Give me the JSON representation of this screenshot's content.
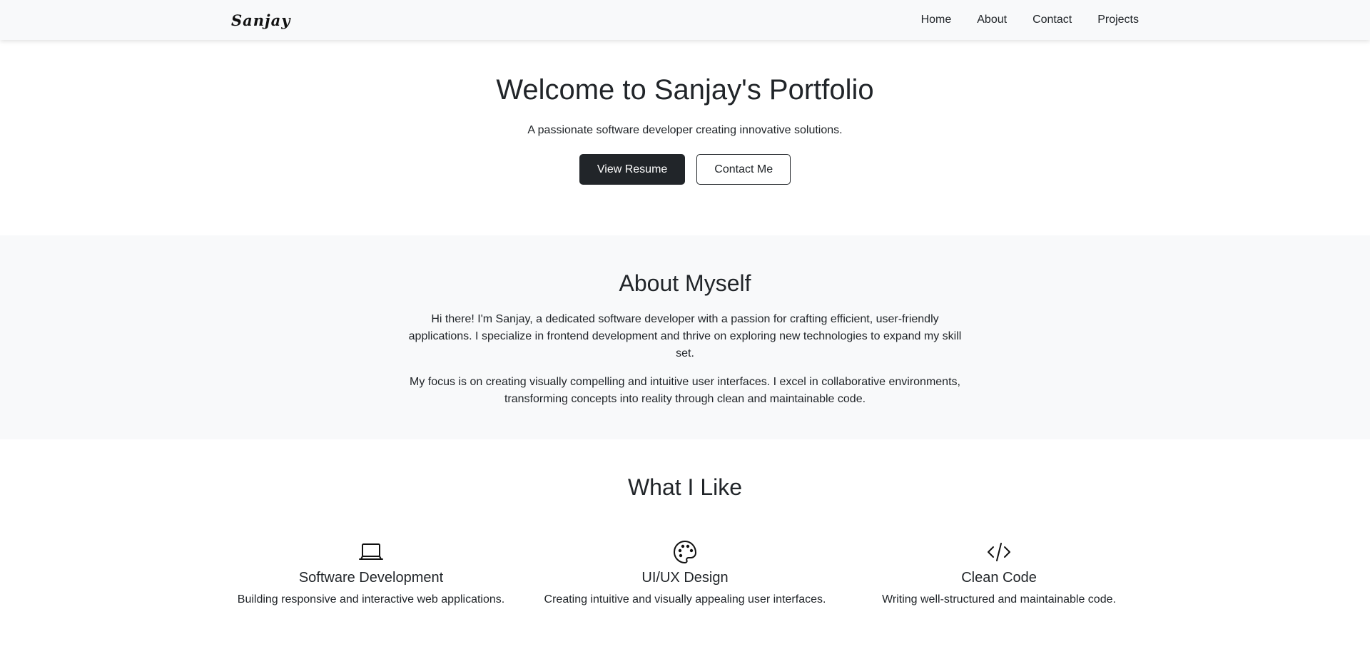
{
  "nav": {
    "brand": "Sanjay",
    "links": [
      "Home",
      "About",
      "Contact",
      "Projects"
    ]
  },
  "hero": {
    "title": "Welcome to Sanjay's Portfolio",
    "subtitle": "A passionate software developer creating innovative solutions.",
    "primary_button": "View Resume",
    "secondary_button": "Contact Me"
  },
  "about": {
    "title": "About Myself",
    "paragraphs": [
      "Hi there! I'm Sanjay, a dedicated software developer with a passion for crafting efficient, user-friendly applications. I specialize in frontend development and thrive on exploring new technologies to expand my skill set.",
      "My focus is on creating visually compelling and intuitive user interfaces. I excel in collaborative environments, transforming concepts into reality through clean and maintainable code."
    ]
  },
  "likes": {
    "title": "What I Like",
    "items": [
      {
        "icon": "laptop-icon",
        "title": "Software Development",
        "description": "Building responsive and interactive web applications."
      },
      {
        "icon": "palette-icon",
        "title": "UI/UX Design",
        "description": "Creating intuitive and visually appealing user interfaces."
      },
      {
        "icon": "code-icon",
        "title": "Clean Code",
        "description": "Writing well-structured and maintainable code."
      }
    ]
  },
  "colors": {
    "text": "#212529",
    "light_bg": "#f8f9fa",
    "dark_button": "#212529"
  }
}
